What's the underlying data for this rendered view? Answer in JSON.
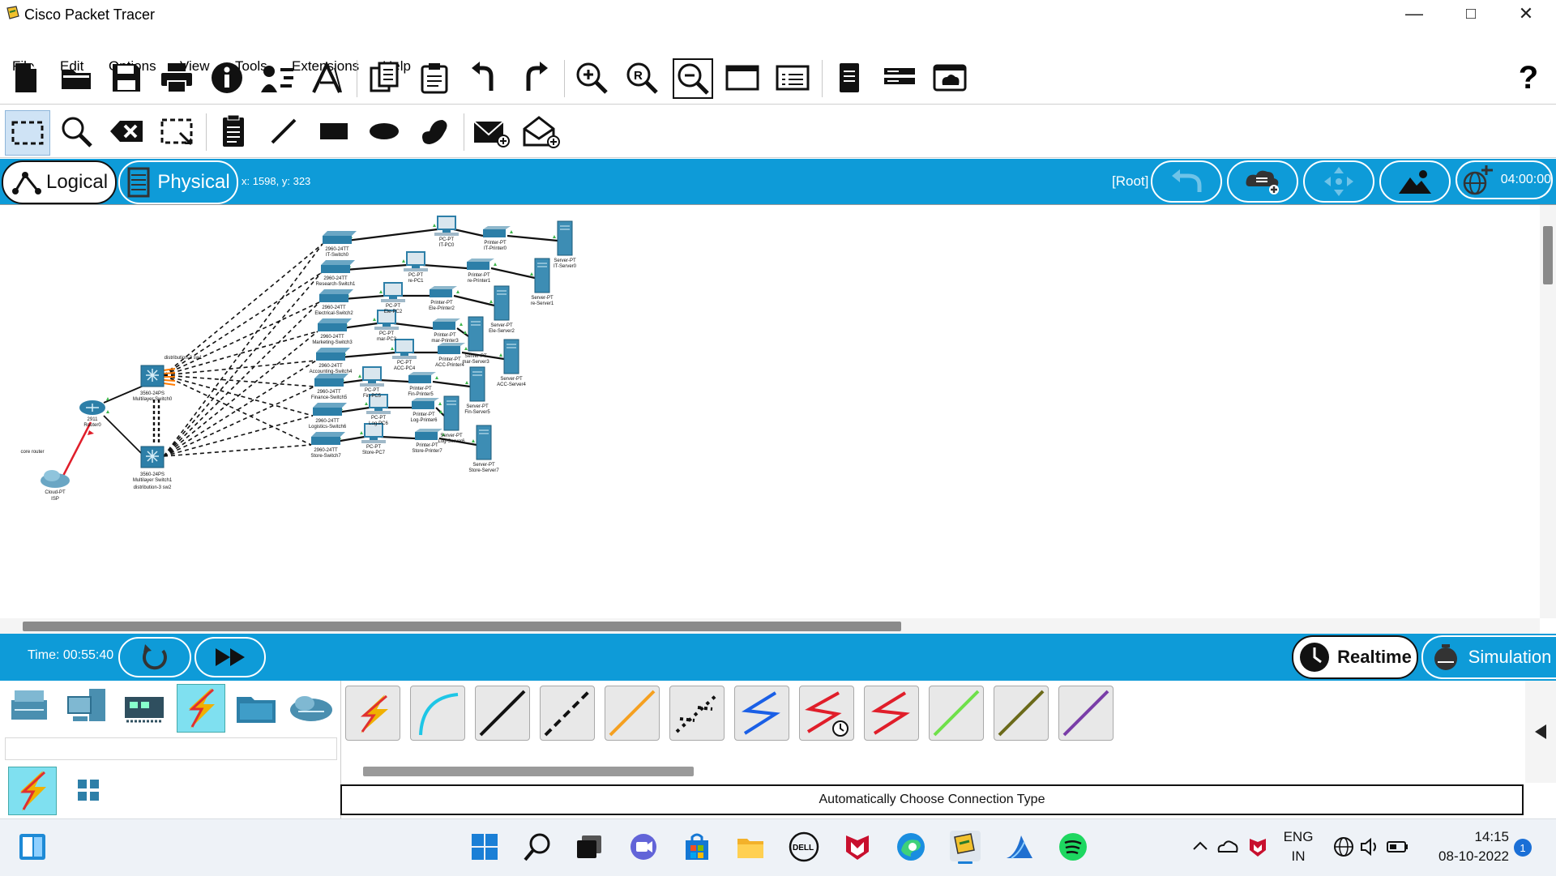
{
  "app": {
    "title": "Cisco Packet Tracer"
  },
  "window_controls": {
    "minimize": "—",
    "maximize": "□",
    "close": "✕"
  },
  "menu": [
    "File",
    "Edit",
    "Options",
    "View",
    "Tools",
    "Extensions",
    "Help"
  ],
  "toolbar_main": {
    "icons": [
      "new-file-icon",
      "open-folder-icon",
      "save-icon",
      "print-icon",
      "info-icon",
      "network-wizard-icon",
      "activity-wizard-icon",
      "copy-icon",
      "paste-icon",
      "undo-icon",
      "redo-icon",
      "zoom-in-icon",
      "zoom-reset-icon",
      "zoom-out-icon",
      "drawing-palette-icon",
      "custom-device-icon",
      "pdu-list-icon",
      "cluster-icon",
      "cloud-view-icon"
    ],
    "help": "?"
  },
  "toolbar_edit": {
    "icons": [
      "select-icon",
      "inspect-icon",
      "delete-icon",
      "resize-icon",
      "note-icon",
      "line-icon",
      "rectangle-icon",
      "ellipse-icon",
      "freeform-icon",
      "add-simple-pdu-icon",
      "add-complex-pdu-icon"
    ]
  },
  "view_bar": {
    "logical_label": "Logical",
    "physical_label": "Physical",
    "coordinates": "x: 1598, y: 323",
    "root_label": "[Root]",
    "clock": "04:00:00"
  },
  "network": {
    "labels": {
      "core_router": "core router",
      "cloud": "Cloud-PT",
      "isp": "ISP",
      "router_model": "2911",
      "router_name": "Router0",
      "ms0_model": "3560-24PS",
      "ms0_name": "Multilayer Switch0",
      "ms0_title": "distribution-3 sw1",
      "ms1_model": "3560-24PS",
      "ms1_name": "Multilayer Switch1",
      "ms1_title": "distribution-3 sw2"
    },
    "switch_model": "2960-24TT",
    "pc_model": "PC-PT",
    "printer_model": "Printer-PT",
    "server_model": "Server-PT",
    "departments": [
      {
        "switch": "IT-Switch0",
        "pc": "IT-PC0",
        "printer": "IT-Printer0",
        "server": "IT-Server0"
      },
      {
        "switch": "Research-Switch1",
        "pc": "re-PC1",
        "printer": "re-Printer1",
        "server": "re-Server1"
      },
      {
        "switch": "Electrical-Switch2",
        "pc": "Ele-PC2",
        "printer": "Ele-Printer2",
        "server": "Ele-Server2"
      },
      {
        "switch": "Marketing-Switch3",
        "pc": "mar-PC3",
        "printer": "mar-Printer3",
        "server": "mar-Server3"
      },
      {
        "switch": "Accounting-Switch4",
        "pc": "ACC-PC4",
        "printer": "ACC-Printer4",
        "server": "ACC-Server4"
      },
      {
        "switch": "Finance-Switch5",
        "pc": "Fin-PC5",
        "printer": "Fin-Printer5",
        "server": "Fin-Server5"
      },
      {
        "switch": "Logistics-Switch6",
        "pc": "Log-PC6",
        "printer": "Log-Printer6",
        "server": "Log-Server6"
      },
      {
        "switch": "Store-Switch7",
        "pc": "Store-PC7",
        "printer": "Store-Printer7",
        "server": "Store-Server7"
      }
    ]
  },
  "time_bar": {
    "time": "Time: 00:55:40",
    "realtime_label": "Realtime",
    "simulation_label": "Simulation"
  },
  "device_categories": [
    "network-devices-icon",
    "end-devices-icon",
    "components-icon",
    "connections-icon",
    "miscellaneous-icon",
    "multiuser-icon"
  ],
  "connection_types": [
    "automatic-connection-icon",
    "console-cable-icon",
    "copper-straight-through-icon",
    "copper-cross-over-icon",
    "fiber-icon",
    "phone-cable-icon",
    "coaxial-cable-icon",
    "serial-dce-icon",
    "serial-dte-icon",
    "octal-cable-icon",
    "iot-custom-cable-icon",
    "usb-cable-icon"
  ],
  "connection_hint": "Automatically Choose Connection Type",
  "colors": {
    "accent_blue": "#0e9bd8",
    "selected_tool": "#7fe0f0"
  },
  "taskbar": {
    "lang_top": "ENG",
    "lang_bottom": "IN",
    "time": "14:15",
    "date": "08-10-2022",
    "notification_count": "1"
  }
}
